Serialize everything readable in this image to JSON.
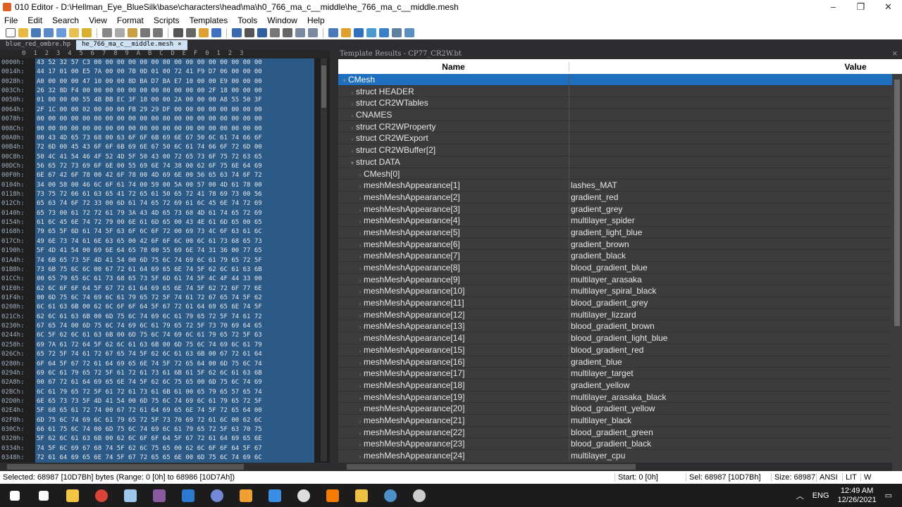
{
  "window": {
    "title": "010 Editor - D:\\Hellman_Eye_BlueSilk\\base\\characters\\head\\ma\\h0_766_ma_c__middle\\he_766_ma_c__middle.mesh",
    "min": "–",
    "max": "❐",
    "close": "✕"
  },
  "menu": [
    "File",
    "Edit",
    "Search",
    "View",
    "Format",
    "Scripts",
    "Templates",
    "Tools",
    "Window",
    "Help"
  ],
  "tabs": [
    {
      "label": "blue_red_ombre.hp"
    },
    {
      "label": "he_766_ma_c__middle.mesh",
      "close": "×"
    }
  ],
  "hex": {
    "header": "     0  1  2  3  4  5  6  7  8  9  A  B  C  D  E  F  0  1  2  3",
    "rows": [
      [
        "0000h:",
        "43 52 32 57 C3 00 00 00 00 00 00 00 00 00 00 00 00 00 00 00"
      ],
      [
        "0014h:",
        "44 17 01 00 E5 7A 00 00 7B 0D 01 00 72 41 F9 D7 06 00 00 00"
      ],
      [
        "0028h:",
        "A0 00 00 00 47 10 00 00 8D BA D7 BA E7 10 00 00 E9 00 00 00"
      ],
      [
        "003Ch:",
        "26 32 8D F4 00 00 00 00 00 00 00 00 00 00 00 2F 18 00 00 00"
      ],
      [
        "0050h:",
        "01 00 00 00 55 4B BB EC 3F 18 00 00 2A 00 00 00 A8 55 50 3F"
      ],
      [
        "0064h:",
        "2F 1C 00 00 02 00 00 00 FB 29 29 DF 00 00 00 00 00 00 00 00"
      ],
      [
        "0078h:",
        "00 00 00 00 00 00 00 00 00 00 00 00 00 00 00 00 00 00 00 00"
      ],
      [
        "008Ch:",
        "00 00 00 00 00 00 00 00 00 00 00 00 00 00 00 00 00 00 00 00"
      ],
      [
        "00A0h:",
        "00 43 4D 65 73 68 00 63 6F 6F 6B 69 6E 67 50 6C 61 74 66 6F"
      ],
      [
        "00B4h:",
        "72 6D 00 45 43 6F 6F 6B 69 6E 67 50 6C 61 74 66 6F 72 6D 00"
      ],
      [
        "00C8h:",
        "50 4C 41 54 46 4F 52 4D 5F 50 43 00 72 65 73 6F 75 72 63 65"
      ],
      [
        "00DCh:",
        "56 65 72 73 69 6F 6E 00 55 69 6E 74 38 00 62 6F 75 6E 64 69"
      ],
      [
        "00F0h:",
        "6E 67 42 6F 78 00 42 6F 78 00 4D 69 6E 00 56 65 63 74 6F 72"
      ],
      [
        "0104h:",
        "34 00 58 00 46 6C 6F 61 74 00 59 00 5A 00 57 00 4D 61 78 00"
      ],
      [
        "0118h:",
        "73 75 72 66 61 63 65 41 72 65 61 50 65 72 41 78 69 73 00 56"
      ],
      [
        "012Ch:",
        "65 63 74 6F 72 33 00 6D 61 74 65 72 69 61 6C 45 6E 74 72 69"
      ],
      [
        "0140h:",
        "65 73 00 61 72 72 61 79 3A 43 4D 65 73 68 4D 61 74 65 72 69"
      ],
      [
        "0154h:",
        "61 6C 45 6E 74 72 79 00 6E 61 6D 65 00 43 4E 61 6D 65 00 65"
      ],
      [
        "0168h:",
        "79 65 5F 6D 61 74 5F 63 6F 6C 6F 72 00 69 73 4C 6F 63 61 6C"
      ],
      [
        "017Ch:",
        "49 6E 73 74 61 6E 63 65 00 42 6F 6F 6C 00 6C 61 73 68 65 73"
      ],
      [
        "0190h:",
        "5F 4D 41 54 00 69 6E 64 65 78 00 55 69 6E 74 31 36 00 77 65"
      ],
      [
        "01A4h:",
        "74 6B 65 73 5F 4D 41 54 00 6D 75 6C 74 69 6C 61 79 65 72 5F"
      ],
      [
        "01B8h:",
        "73 6B 75 6C 6C 00 67 72 61 64 69 65 6E 74 5F 62 6C 61 63 6B"
      ],
      [
        "01CCh:",
        "00 65 79 65 6C 61 73 68 65 73 5F 6D 61 74 5F 4C 4F 44 33 00"
      ],
      [
        "01E0h:",
        "62 6C 6F 6F 64 5F 67 72 61 64 69 65 6E 74 5F 62 72 6F 77 6E"
      ],
      [
        "01F4h:",
        "00 6D 75 6C 74 69 6C 61 79 65 72 5F 74 61 72 67 65 74 5F 62"
      ],
      [
        "0208h:",
        "6C 61 63 6B 00 62 6C 6F 6F 64 5F 67 72 61 64 69 65 6E 74 5F"
      ],
      [
        "021Ch:",
        "62 6C 61 63 6B 00 6D 75 6C 74 69 6C 61 79 65 72 5F 74 61 72"
      ],
      [
        "0230h:",
        "67 65 74 00 6D 75 6C 74 69 6C 61 79 65 72 5F 73 70 69 64 65"
      ],
      [
        "0244h:",
        "6C 5F 62 6C 61 63 6B 00 6D 75 6C 74 69 6C 61 79 65 72 5F 63"
      ],
      [
        "0258h:",
        "69 7A 61 72 64 5F 62 6C 61 63 6B 00 6D 75 6C 74 69 6C 61 79"
      ],
      [
        "026Ch:",
        "65 72 5F 74 61 72 67 65 74 5F 62 6C 61 63 6B 00 67 72 61 64"
      ],
      [
        "0280h:",
        "6F 64 5F 67 72 61 64 69 65 6E 74 5F 72 65 64 00 6D 75 6C 74"
      ],
      [
        "0294h:",
        "69 6C 61 79 65 72 5F 61 72 61 73 61 6B 61 5F 62 6C 61 63 6B"
      ],
      [
        "02A8h:",
        "00 67 72 61 64 69 65 6E 74 5F 62 6C 75 65 00 6D 75 6C 74 69"
      ],
      [
        "02BCh:",
        "6C 61 79 65 72 5F 61 72 61 73 61 6B 61 00 65 79 65 57 65 74"
      ],
      [
        "02D0h:",
        "6E 65 73 73 5F 4D 41 54 00 6D 75 6C 74 69 6C 61 79 65 72 5F"
      ],
      [
        "02E4h:",
        "5F 68 65 61 72 74 00 67 72 61 64 69 65 6E 74 5F 72 65 64 00"
      ],
      [
        "02F8h:",
        "6D 75 6C 74 69 6C 61 79 65 72 5F 73 70 69 72 61 6C 00 62 6C"
      ],
      [
        "030Ch:",
        "66 61 75 6C 74 00 6D 75 6C 74 69 6C 61 79 65 72 5F 63 70 75"
      ],
      [
        "0320h:",
        "5F 62 6C 61 63 6B 00 62 6C 6F 6F 64 5F 67 72 61 64 69 65 6E"
      ],
      [
        "0334h:",
        "74 5F 6C 69 67 68 74 5F 62 6C 75 65 00 62 6C 6F 6F 64 5F 67"
      ],
      [
        "0348h:",
        "72 61 64 69 65 6E 74 5F 67 72 65 65 6E 00 6D 75 6C 74 69 6C"
      ]
    ]
  },
  "template": {
    "title": "Template Results - CP77_CR2W.bt",
    "col_name": "Name",
    "col_value": "Value",
    "rows": [
      {
        "name": "CMesh",
        "value": "",
        "indent": 0,
        "arrow": "▾",
        "selected": true
      },
      {
        "name": "struct HEADER",
        "value": "",
        "indent": 1,
        "arrow": "›"
      },
      {
        "name": "struct CR2WTables",
        "value": "",
        "indent": 1,
        "arrow": "›"
      },
      {
        "name": "CNAMES",
        "value": "",
        "indent": 1,
        "arrow": "›"
      },
      {
        "name": "struct CR2WProperty",
        "value": "",
        "indent": 1,
        "arrow": "›"
      },
      {
        "name": "struct CR2WExport",
        "value": "",
        "indent": 1,
        "arrow": "›"
      },
      {
        "name": "struct CR2WBuffer[2]",
        "value": "",
        "indent": 1,
        "arrow": "›"
      },
      {
        "name": "struct DATA",
        "value": "",
        "indent": 1,
        "arrow": "▾"
      },
      {
        "name": "CMesh[0]",
        "value": "",
        "indent": 2,
        "arrow": "›"
      },
      {
        "name": "meshMeshAppearance[1]",
        "value": "lashes_MAT",
        "indent": 2,
        "arrow": "›"
      },
      {
        "name": "meshMeshAppearance[2]",
        "value": "gradient_red",
        "indent": 2,
        "arrow": "›"
      },
      {
        "name": "meshMeshAppearance[3]",
        "value": "gradient_grey",
        "indent": 2,
        "arrow": "›"
      },
      {
        "name": "meshMeshAppearance[4]",
        "value": "multilayer_spider",
        "indent": 2,
        "arrow": "›"
      },
      {
        "name": "meshMeshAppearance[5]",
        "value": "gradient_light_blue",
        "indent": 2,
        "arrow": "›"
      },
      {
        "name": "meshMeshAppearance[6]",
        "value": "gradient_brown",
        "indent": 2,
        "arrow": "›"
      },
      {
        "name": "meshMeshAppearance[7]",
        "value": "gradient_black",
        "indent": 2,
        "arrow": "›"
      },
      {
        "name": "meshMeshAppearance[8]",
        "value": "blood_gradient_blue",
        "indent": 2,
        "arrow": "›"
      },
      {
        "name": "meshMeshAppearance[9]",
        "value": "multilayer_arasaka",
        "indent": 2,
        "arrow": "›"
      },
      {
        "name": "meshMeshAppearance[10]",
        "value": "multilayer_spiral_black",
        "indent": 2,
        "arrow": "›"
      },
      {
        "name": "meshMeshAppearance[11]",
        "value": "blood_gradient_grey",
        "indent": 2,
        "arrow": "›"
      },
      {
        "name": "meshMeshAppearance[12]",
        "value": "multilayer_lizzard",
        "indent": 2,
        "arrow": "›"
      },
      {
        "name": "meshMeshAppearance[13]",
        "value": "blood_gradient_brown",
        "indent": 2,
        "arrow": "›"
      },
      {
        "name": "meshMeshAppearance[14]",
        "value": "blood_gradient_light_blue",
        "indent": 2,
        "arrow": "›"
      },
      {
        "name": "meshMeshAppearance[15]",
        "value": "blood_gradient_red",
        "indent": 2,
        "arrow": "›"
      },
      {
        "name": "meshMeshAppearance[16]",
        "value": "gradient_blue",
        "indent": 2,
        "arrow": "›"
      },
      {
        "name": "meshMeshAppearance[17]",
        "value": "multilayer_target",
        "indent": 2,
        "arrow": "›"
      },
      {
        "name": "meshMeshAppearance[18]",
        "value": "gradient_yellow",
        "indent": 2,
        "arrow": "›"
      },
      {
        "name": "meshMeshAppearance[19]",
        "value": "multilayer_arasaka_black",
        "indent": 2,
        "arrow": "›"
      },
      {
        "name": "meshMeshAppearance[20]",
        "value": "blood_gradient_yellow",
        "indent": 2,
        "arrow": "›"
      },
      {
        "name": "meshMeshAppearance[21]",
        "value": "multilayer_black",
        "indent": 2,
        "arrow": "›"
      },
      {
        "name": "meshMeshAppearance[22]",
        "value": "blood_gradient_green",
        "indent": 2,
        "arrow": "›"
      },
      {
        "name": "meshMeshAppearance[23]",
        "value": "blood_gradient_black",
        "indent": 2,
        "arrow": "›"
      },
      {
        "name": "meshMeshAppearance[24]",
        "value": "multilayer_cpu",
        "indent": 2,
        "arrow": "›"
      }
    ]
  },
  "status": {
    "selected": "Selected: 68987 [10D7Bh] bytes (Range: 0 [0h] to 68986 [10D7Ah])",
    "start": "Start: 0 [0h]",
    "sel": "Sel: 68987 [10D7Bh]",
    "size": "Size: 68987",
    "encoding": "ANSI",
    "endian": "LIT",
    "mode": "W"
  },
  "taskbar": {
    "lang": "ENG",
    "time": "12:49 AM",
    "date": "12/26/2021",
    "apps": [
      "start-icon",
      "search-icon",
      "file-explorer-icon",
      "chrome-icon",
      "notepad-icon",
      "winrar-icon",
      "app-icon",
      "discord-icon",
      "010-editor-icon",
      "app-window-icon",
      "obs-icon",
      "search-tool-icon",
      "folder-tool-icon",
      "steam-icon",
      "unity-icon"
    ],
    "colors": {
      "start-icon": "#ffffff",
      "search-icon": "#ffffff",
      "file-explorer-icon": "#f3c744",
      "chrome-icon": "#db4437",
      "notepad-icon": "#9ec9ef",
      "winrar-icon": "#8a5a9e",
      "app-icon": "#2b79d0",
      "discord-icon": "#7289da",
      "010-editor-icon": "#f0a030",
      "app-window-icon": "#3a8ee6",
      "obs-icon": "#dddddd",
      "search-tool-icon": "#f57c00",
      "folder-tool-icon": "#f0c040",
      "steam-icon": "#4a8fc7",
      "unity-icon": "#cccccc"
    }
  }
}
